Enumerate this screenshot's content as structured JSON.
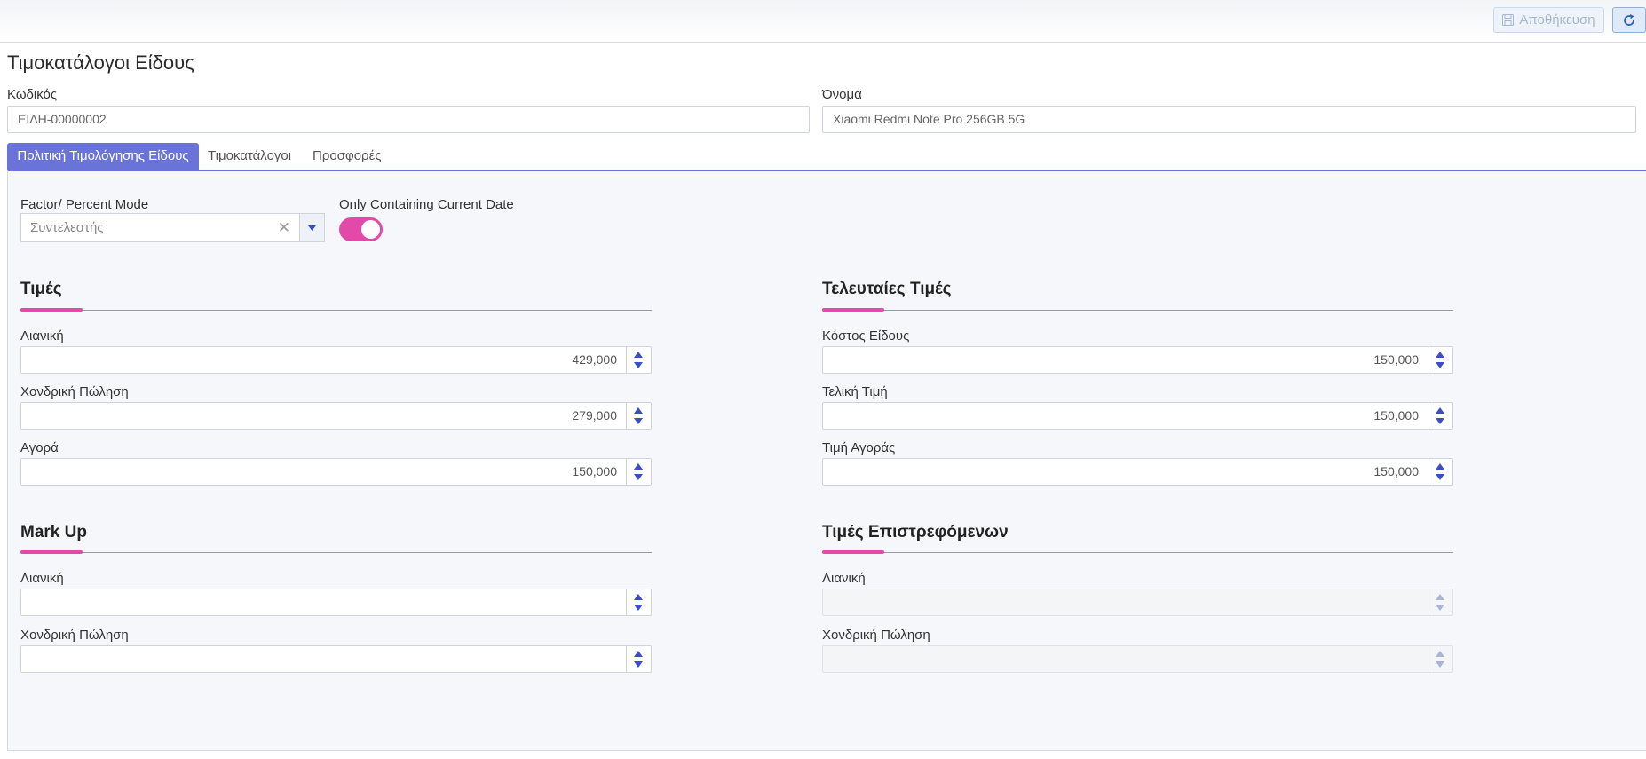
{
  "toolbar": {
    "save_label": "Αποθήκευση",
    "save_icon": "floppy-disk-icon",
    "refresh_icon": "refresh-icon"
  },
  "page": {
    "title": "Τιμοκατάλογοι Είδους"
  },
  "header_fields": {
    "code_label": "Κωδικός",
    "code_value": "ΕΙΔΗ-00000002",
    "name_label": "Όνομα",
    "name_value": "Xiaomi Redmi Note Pro 256GB 5G"
  },
  "tabs": [
    {
      "label": "Πολιτική Τιμολόγησης Είδους",
      "active": true
    },
    {
      "label": "Τιμοκατάλογοι",
      "active": false
    },
    {
      "label": "Προσφορές",
      "active": false
    }
  ],
  "options": {
    "mode_label": "Factor/ Percent Mode",
    "mode_value": "Συντελεστής",
    "current_date_label": "Only Containing Current Date",
    "current_date_on": true
  },
  "prices": {
    "title": "Τιμές",
    "retail_label": "Λιανική",
    "retail_value": "429,000",
    "wholesale_label": "Χονδρική Πώληση",
    "wholesale_value": "279,000",
    "purchase_label": "Αγορά",
    "purchase_value": "150,000"
  },
  "last_prices": {
    "title": "Τελευταίες Τιμές",
    "cost_label": "Κόστος Είδους",
    "cost_value": "150,000",
    "final_label": "Τελική Τιμή",
    "final_value": "150,000",
    "purchase_label": "Τιμή Αγοράς",
    "purchase_value": "150,000"
  },
  "markup": {
    "title": "Mark Up",
    "retail_label": "Λιανική",
    "wholesale_label": "Χονδρική Πώληση"
  },
  "returns": {
    "title": "Τιμές Επιστρεφόμενων",
    "retail_label": "Λιανική",
    "wholesale_label": "Χονδρική Πώληση"
  },
  "colors": {
    "accent_tab": "#6a74d8",
    "accent_pink": "#e24aa9",
    "spinner_arrow": "#3b4fc4"
  }
}
